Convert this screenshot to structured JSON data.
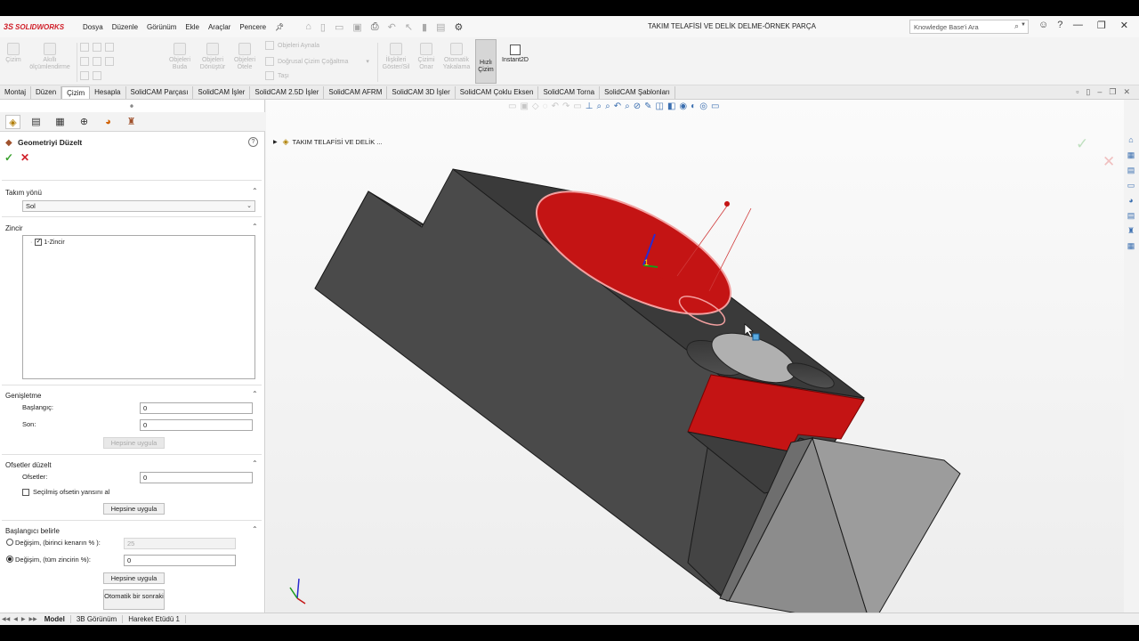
{
  "app": {
    "logo_ds": "3S",
    "logo_name": "SOLIDWORKS",
    "menu": [
      "Dosya",
      "Düzenle",
      "Görünüm",
      "Ekle",
      "Araçlar",
      "Pencere"
    ],
    "document_title": "TAKIM TELAFİSİ VE DELİK DELME-ÖRNEK PARÇA",
    "search_placeholder": "Knowledge Base'i Ara"
  },
  "ribbon": {
    "items": [
      {
        "label": "Çizim"
      },
      {
        "label": "Akıllı ölçümlendirme"
      },
      {
        "label": "Objeleri Buda"
      },
      {
        "label": "Objeleri Dönüştür"
      },
      {
        "label": "Objeleri Ötele"
      },
      {
        "label": "Objeleri Aynala"
      },
      {
        "label": "Doğrusal Çizim Çoğaltma"
      },
      {
        "label": "Taşı"
      },
      {
        "label": "İlişkileri Göster/Sil"
      },
      {
        "label": "Çizimi Onar"
      },
      {
        "label": "Otomatik Yakalama"
      },
      {
        "label": "Hızlı Çizim"
      },
      {
        "label": "Instant2D"
      }
    ]
  },
  "tabs": [
    "Montaj",
    "Düzen",
    "Çizim",
    "Hesapla",
    "SolidCAM Parçası",
    "SolidCAM İşler",
    "SolidCAM 2.5D İşler",
    "SolidCAM AFRM",
    "SolidCAM 3D İşler",
    "SolidCAM Çoklu Eksen",
    "SolidCAM Torna",
    "SolidCAM Şablonları"
  ],
  "active_tab": "Çizim",
  "pm": {
    "title": "Geometriyi Düzelt",
    "tool_direction": {
      "label": "Takım yönü",
      "value": "Sol"
    },
    "chain": {
      "label": "Zincir",
      "item": "1-Zincir"
    },
    "extension": {
      "label": "Genişletme",
      "start_label": "Başlangıç:",
      "start_value": "0",
      "end_label": "Son:",
      "end_value": "0",
      "apply_all": "Hepsine uygula"
    },
    "offsets": {
      "label": "Ofsetler düzelt",
      "offsets_label": "Ofsetler:",
      "offsets_value": "0",
      "mirror_label": "Seçilmiş ofsetin yansını al",
      "apply_all": "Hepsine uygula"
    },
    "start_define": {
      "label": "Başlangıcı belirle",
      "opt1_label": "Değişim,  (birinci kenarın % ):",
      "opt1_value": "25",
      "opt2_label": "Değişim, (tüm zincirin %):",
      "opt2_value": "0",
      "apply_all": "Hepsine uygula",
      "auto_next": "Otomatik bir sonraki"
    }
  },
  "viewport": {
    "tree_label": "TAKIM TELAFİSİ VE DELİK ...",
    "colors": {
      "body": "#4a4a4a",
      "selection": "#c41414",
      "light_face": "#8c8c8c"
    }
  },
  "bottom_tabs": [
    "Model",
    "3B Görünüm",
    "Hareket Etüdü 1"
  ],
  "active_bottom_tab": "Model"
}
